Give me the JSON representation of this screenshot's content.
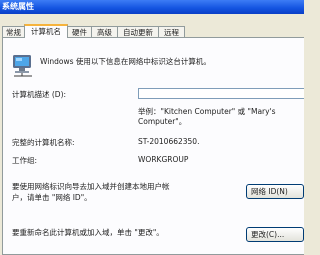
{
  "window": {
    "title": "系统属性"
  },
  "tabs": [
    {
      "label": "常规",
      "active": false
    },
    {
      "label": "计算机名",
      "active": true
    },
    {
      "label": "硬件",
      "active": false
    },
    {
      "label": "高级",
      "active": false
    },
    {
      "label": "自动更新",
      "active": false
    },
    {
      "label": "远程",
      "active": false
    }
  ],
  "panel": {
    "intro": "Windows 使用以下信息在网络中标识这台计算机。",
    "description_label": "计算机描述 (D):",
    "description_value": "",
    "example_line1": "举例：\"Kitchen Computer\" 或 \"Mary's",
    "example_line2": "Computer\"。",
    "fullname_label": "完整的计算机名称:",
    "fullname_value": "ST-2010662350.",
    "workgroup_label": "工作组:",
    "workgroup_value": "WORKGROUP",
    "network_id_text_line1": "要使用网络标识向导去加入域并创建本地用户帐",
    "network_id_text_line2": "户，请单击 \"网络 ID\"。",
    "network_id_button": "网络 ID(N)",
    "rename_text": "要重新命名此计算机或加入域，单击 \"更改\"。",
    "change_button": "更改(C)..."
  }
}
